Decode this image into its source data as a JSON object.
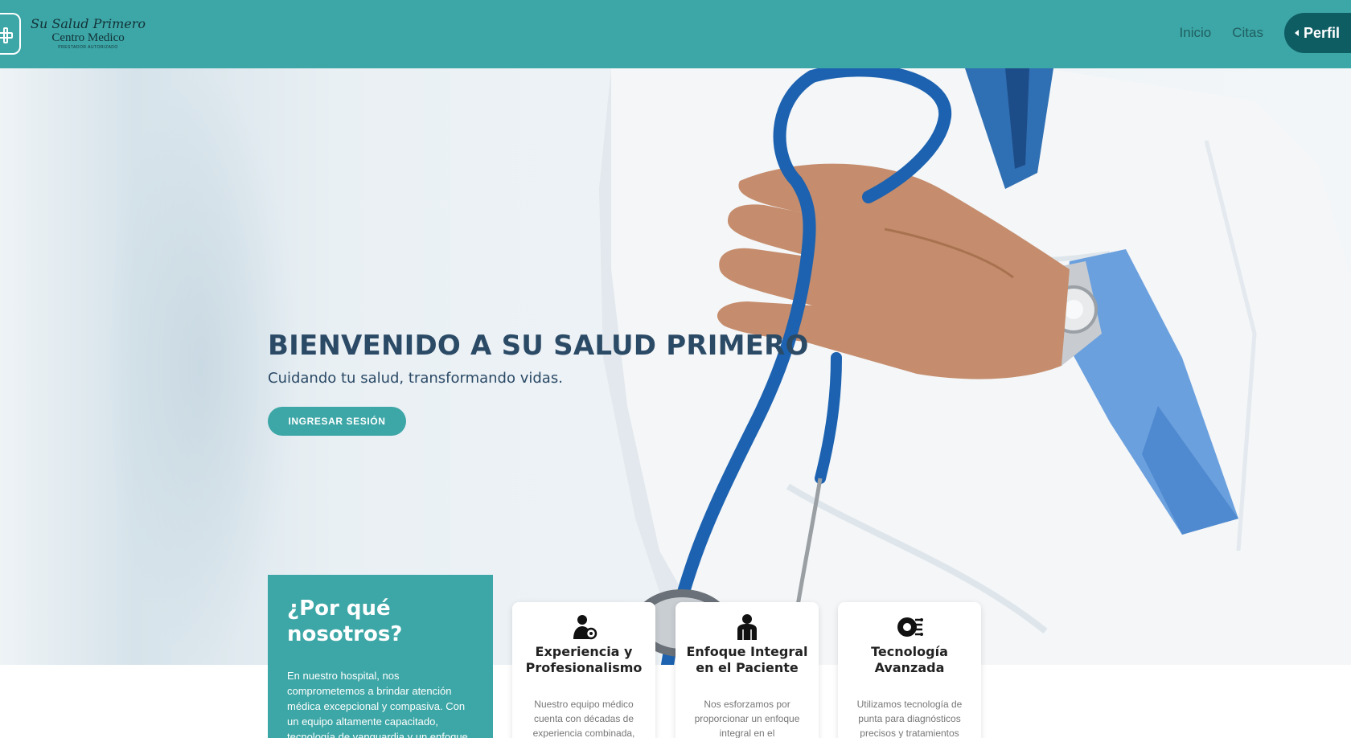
{
  "nav": {
    "logo": {
      "script_line": "Su Salud Primero",
      "main_line": "Centro Medico",
      "small_line": "PRESTADOR AUTORIZADO"
    },
    "links": [
      "Inicio",
      "Citas"
    ],
    "profile_label": "Perfil"
  },
  "hero": {
    "title": "BIENVENIDO A SU SALUD PRIMERO",
    "subtitle": "Cuidando tu salud, transformando vidas.",
    "button": "INGRESAR SESIÓN"
  },
  "why": {
    "title": "¿Por qué nosotros?",
    "text": "En nuestro hospital, nos comprometemos a brindar atención médica excepcional y compasiva. Con un equipo altamente capacitado, tecnología de vanguardia y un enfoque centrado en"
  },
  "cards": [
    {
      "icon": "doctor-gear-icon",
      "title": "Experiencia y Profesionalismo",
      "text": "Nuestro equipo médico cuenta con décadas de experiencia combinada,"
    },
    {
      "icon": "patient-icon",
      "title": "Enfoque Integral en el Paciente",
      "text": "Nos esforzamos por proporcionar un enfoque integral en el"
    },
    {
      "icon": "technology-icon",
      "title": "Tecnología Avanzada",
      "text": "Utilizamos tecnología de punta para diagnósticos precisos y tratamientos"
    }
  ],
  "colors": {
    "primary": "#3da6a6",
    "dark_teal": "#0e5d63",
    "hero_text": "#2b4a66"
  }
}
